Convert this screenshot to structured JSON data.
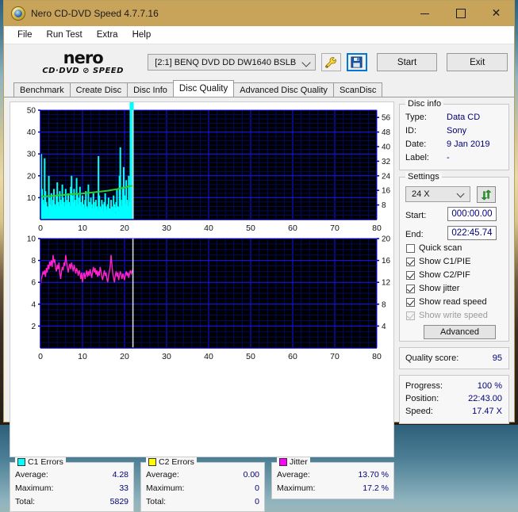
{
  "window": {
    "title": "Nero CD-DVD Speed 4.7.7.16",
    "icon": "nero-disc-icon",
    "minimize": "minimize-icon",
    "maximize": "maximize-icon",
    "close": "close-icon"
  },
  "menu": {
    "items": [
      "File",
      "Run Test",
      "Extra",
      "Help"
    ]
  },
  "brand": {
    "line1": "nero",
    "line2": "CD·DVD ⊘ SPEED"
  },
  "toolbar": {
    "drive": "[2:1]   BENQ DVD DD DW1640 BSLB",
    "tools_icon": "tools-wrench-icon",
    "save_icon": "save-floppy-icon",
    "start_label": "Start",
    "exit_label": "Exit"
  },
  "tabs": [
    {
      "label": "Benchmark",
      "active": false
    },
    {
      "label": "Create Disc",
      "active": false
    },
    {
      "label": "Disc Info",
      "active": false
    },
    {
      "label": "Disc Quality",
      "active": true
    },
    {
      "label": "Advanced Disc Quality",
      "active": false
    },
    {
      "label": "ScanDisc",
      "active": false
    }
  ],
  "disc_info": {
    "title": "Disc info",
    "rows": [
      {
        "label": "Type:",
        "value": "Data CD"
      },
      {
        "label": "ID:",
        "value": "Sony"
      },
      {
        "label": "Date:",
        "value": "9 Jan 2019"
      },
      {
        "label": "Label:",
        "value": "-"
      }
    ]
  },
  "settings": {
    "title": "Settings",
    "speed": "24 X",
    "refresh_icon": "refresh-arrows-icon",
    "start_label": "Start:",
    "start_value": "000:00.00",
    "end_label": "End:",
    "end_value": "022:45.74",
    "checkboxes": [
      {
        "label": "Quick scan",
        "checked": false,
        "disabled": false
      },
      {
        "label": "Show C1/PIE",
        "checked": true,
        "disabled": false
      },
      {
        "label": "Show C2/PIF",
        "checked": true,
        "disabled": false
      },
      {
        "label": "Show jitter",
        "checked": true,
        "disabled": false
      },
      {
        "label": "Show read speed",
        "checked": true,
        "disabled": false
      },
      {
        "label": "Show write speed",
        "checked": true,
        "disabled": true
      }
    ],
    "advanced_label": "Advanced"
  },
  "quality": {
    "label": "Quality score:",
    "value": "95"
  },
  "status": {
    "rows": [
      {
        "label": "Progress:",
        "value": "100 %"
      },
      {
        "label": "Position:",
        "value": "22:43.00"
      },
      {
        "label": "Speed:",
        "value": "17.47 X"
      }
    ]
  },
  "stats": [
    {
      "title": "C1 Errors",
      "color": "#00ffff",
      "rows": [
        {
          "label": "Average:",
          "value": "4.28"
        },
        {
          "label": "Maximum:",
          "value": "33"
        },
        {
          "label": "Total:",
          "value": "5829"
        }
      ]
    },
    {
      "title": "C2 Errors",
      "color": "#ffff00",
      "rows": [
        {
          "label": "Average:",
          "value": "0.00"
        },
        {
          "label": "Maximum:",
          "value": "0"
        },
        {
          "label": "Total:",
          "value": "0"
        }
      ]
    },
    {
      "title": "Jitter",
      "color": "#ff00ff",
      "rows": [
        {
          "label": "Average:",
          "value": "13.70 %"
        },
        {
          "label": "Maximum:",
          "value": "17.2 %"
        }
      ]
    }
  ],
  "chart_data": [
    {
      "type": "area",
      "name": "c1-errors-chart",
      "title": "C1 Errors / read speed",
      "xlabel": "",
      "ylabel": "C1 errors",
      "xlim": [
        0,
        80
      ],
      "ylim": [
        0,
        50
      ],
      "y2lim": [
        0,
        60
      ],
      "xticks": [
        0,
        10,
        20,
        30,
        40,
        50,
        60,
        70,
        80
      ],
      "yticks": [
        10,
        20,
        30,
        40,
        50
      ],
      "y2ticks": [
        8,
        16,
        24,
        32,
        40,
        48,
        56
      ],
      "grid": true,
      "scan_end_x": 22.0,
      "series": [
        {
          "name": "C1 errors",
          "color": "#00ffff",
          "kind": "area",
          "x": [
            0.0,
            0.2,
            0.4,
            0.6,
            0.8,
            1.0,
            1.2,
            1.4,
            1.6,
            1.8,
            2.0,
            2.2,
            2.4,
            2.6,
            2.8,
            3.0,
            3.2,
            3.4,
            3.6,
            3.8,
            4.0,
            4.2,
            4.4,
            4.6,
            4.8,
            5.0,
            5.2,
            5.4,
            5.6,
            5.8,
            6.0,
            6.2,
            6.4,
            6.6,
            6.8,
            7.0,
            7.2,
            7.4,
            7.6,
            7.8,
            8.0,
            8.2,
            8.4,
            8.6,
            8.8,
            9.0,
            9.2,
            9.4,
            9.6,
            9.8,
            10.0,
            10.2,
            10.4,
            10.6,
            10.8,
            11.0,
            11.2,
            11.4,
            11.6,
            11.8,
            12.0,
            12.2,
            12.4,
            12.6,
            12.8,
            13.0,
            13.2,
            13.4,
            13.6,
            13.8,
            14.0,
            14.2,
            14.4,
            14.6,
            14.8,
            15.0,
            15.2,
            15.4,
            15.6,
            15.8,
            16.0,
            16.2,
            16.4,
            16.6,
            16.8,
            17.0,
            17.2,
            17.4,
            17.6,
            17.8,
            18.0,
            18.2,
            18.4,
            18.6,
            18.8,
            19.0,
            19.2,
            19.4,
            19.6,
            19.8,
            20.0,
            20.2,
            20.4,
            20.6,
            20.8,
            21.0,
            21.2,
            21.4,
            21.6,
            21.8,
            22.0
          ],
          "y": [
            12,
            30,
            14,
            9,
            7,
            28,
            13,
            8,
            6,
            5,
            20,
            10,
            7,
            12,
            6,
            9,
            14,
            7,
            6,
            11,
            17,
            8,
            6,
            13,
            9,
            7,
            16,
            10,
            8,
            6,
            14,
            9,
            7,
            12,
            8,
            6,
            15,
            20,
            11,
            8,
            14,
            9,
            6,
            19,
            12,
            7,
            10,
            15,
            8,
            6,
            11,
            7,
            5,
            9,
            13,
            6,
            5,
            16,
            8,
            6,
            10,
            7,
            5,
            12,
            8,
            5,
            9,
            6,
            4,
            29,
            11,
            6,
            5,
            9,
            7,
            4,
            8,
            12,
            6,
            4,
            7,
            10,
            5,
            4,
            9,
            6,
            4,
            11,
            7,
            3,
            8,
            14,
            6,
            4,
            20,
            33,
            9,
            6,
            15,
            24,
            11,
            7,
            18,
            9,
            6,
            20,
            8
          ]
        },
        {
          "name": "read speed",
          "color": "#33cc33",
          "kind": "line",
          "x": [
            0,
            2,
            4,
            6,
            8,
            10,
            12,
            14,
            16,
            18,
            20,
            21,
            22
          ],
          "y2": [
            12.5,
            12.8,
            13.2,
            13.6,
            14.0,
            14.3,
            14.8,
            15.3,
            15.8,
            16.6,
            17.5,
            18.2,
            18.6
          ]
        }
      ]
    },
    {
      "type": "line",
      "name": "jitter-chart",
      "title": "Jitter",
      "xlabel": "",
      "ylabel": "Jitter %",
      "xlim": [
        0,
        80
      ],
      "ylim": [
        0,
        10
      ],
      "y2lim": [
        0,
        20
      ],
      "xticks": [
        0,
        10,
        20,
        30,
        40,
        50,
        60,
        70,
        80
      ],
      "yticks": [
        2,
        4,
        6,
        8,
        10
      ],
      "y2ticks": [
        4,
        8,
        12,
        16,
        20
      ],
      "grid": true,
      "scan_end_x": 22.0,
      "series": [
        {
          "name": "jitter",
          "color": "#ff22cc",
          "kind": "line",
          "x": [
            0.0,
            0.2,
            0.4,
            0.6,
            0.8,
            1.0,
            1.2,
            1.4,
            1.6,
            1.8,
            2.0,
            2.2,
            2.4,
            2.6,
            2.8,
            3.0,
            3.2,
            3.4,
            3.6,
            3.8,
            4.0,
            4.2,
            4.4,
            4.6,
            4.8,
            5.0,
            5.2,
            5.4,
            5.6,
            5.8,
            6.0,
            6.2,
            6.4,
            6.6,
            6.8,
            7.0,
            7.2,
            7.4,
            7.6,
            7.8,
            8.0,
            8.2,
            8.4,
            8.6,
            8.8,
            9.0,
            9.2,
            9.4,
            9.6,
            9.8,
            10.0,
            10.2,
            10.4,
            10.6,
            10.8,
            11.0,
            11.2,
            11.4,
            11.6,
            11.8,
            12.0,
            12.2,
            12.4,
            12.6,
            12.8,
            13.0,
            13.2,
            13.4,
            13.6,
            13.8,
            14.0,
            14.2,
            14.4,
            14.6,
            14.8,
            15.0,
            15.2,
            15.4,
            15.6,
            15.8,
            16.0,
            16.2,
            16.4,
            16.6,
            16.8,
            17.0,
            17.2,
            17.4,
            17.6,
            17.8,
            18.0,
            18.2,
            18.4,
            18.6,
            18.8,
            19.0,
            19.2,
            19.4,
            19.6,
            19.8,
            20.0,
            20.2,
            20.4,
            20.6,
            20.8,
            21.0,
            21.2,
            21.4,
            21.6,
            21.8,
            22.0
          ],
          "y": [
            5.6,
            6.3,
            6.6,
            7.0,
            6.7,
            7.1,
            6.5,
            7.3,
            6.9,
            7.6,
            7.2,
            7.9,
            7.5,
            8.0,
            7.4,
            8.5,
            7.8,
            8.1,
            7.3,
            7.0,
            7.6,
            7.2,
            7.8,
            6.9,
            6.3,
            7.0,
            7.4,
            7.1,
            7.8,
            7.5,
            8.5,
            7.9,
            7.3,
            6.9,
            7.4,
            7.7,
            7.2,
            7.8,
            7.4,
            7.0,
            7.6,
            7.2,
            6.8,
            7.3,
            7.0,
            6.6,
            7.1,
            6.8,
            6.3,
            6.9,
            6.0,
            6.6,
            6.9,
            6.3,
            6.7,
            7.1,
            6.5,
            7.0,
            6.6,
            7.2,
            6.8,
            6.4,
            7.0,
            7.4,
            6.9,
            7.3,
            6.7,
            7.1,
            6.5,
            7.0,
            6.6,
            7.4,
            7.0,
            6.5,
            6.2,
            6.7,
            7.1,
            6.6,
            6.9,
            6.3,
            6.0,
            6.6,
            7.0,
            7.5,
            8.5,
            7.6,
            6.8,
            6.4,
            6.0,
            6.6,
            7.0,
            6.5,
            6.9,
            6.2,
            6.6,
            7.0,
            6.7,
            6.3,
            6.8,
            6.5,
            6.2,
            6.7,
            7.0,
            6.6,
            6.9,
            6.4,
            6.8,
            7.1,
            6.8,
            7.0,
            7.2
          ]
        }
      ]
    }
  ]
}
